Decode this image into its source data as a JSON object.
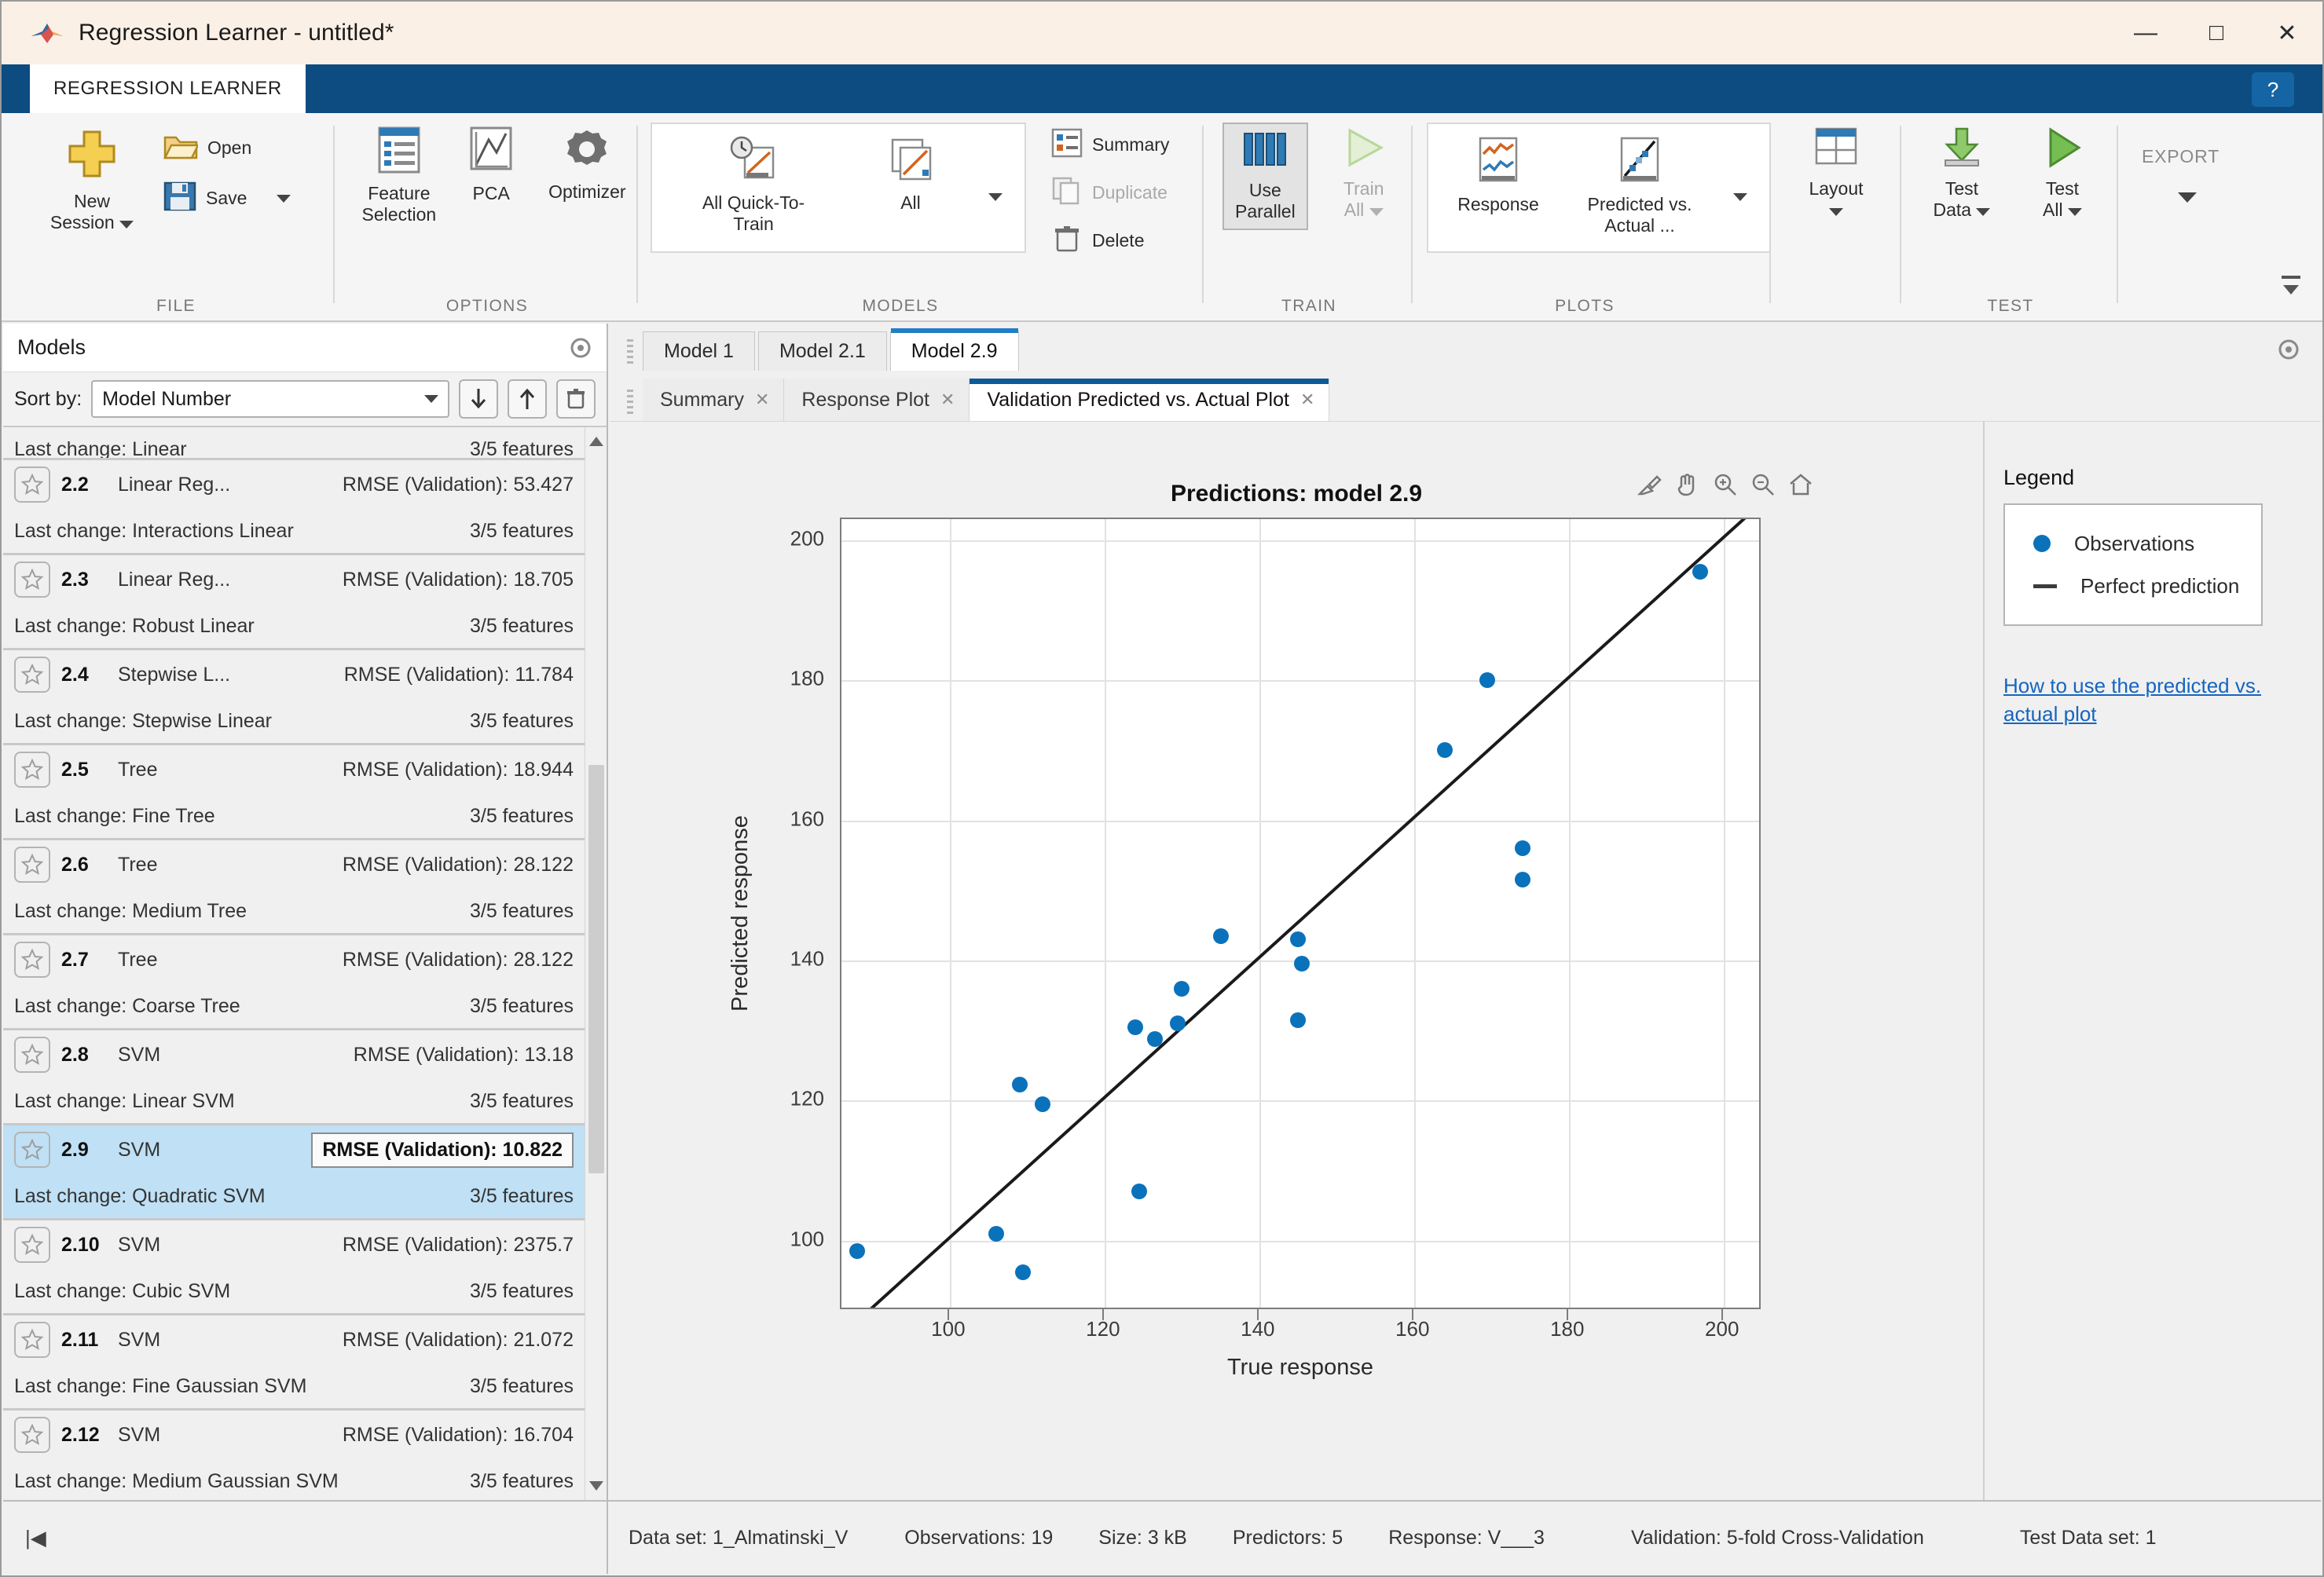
{
  "window": {
    "title": "Regression Learner - untitled*",
    "app_icon": "matlab-icon",
    "minimize": "—",
    "maximize": "□",
    "close": "✕"
  },
  "ribbon": {
    "tab_label": "REGRESSION LEARNER",
    "help_label": "?",
    "groups": [
      {
        "caption": "FILE"
      },
      {
        "caption": "OPTIONS"
      },
      {
        "caption": "MODELS"
      },
      {
        "caption": "TRAIN"
      },
      {
        "caption": "PLOTS"
      },
      {
        "caption": "TEST"
      },
      {
        "caption": ""
      }
    ],
    "file": {
      "new_session": "New\nSession",
      "new_session_line1": "New",
      "new_session_line2": "Session",
      "open": "Open",
      "save": "Save"
    },
    "options": {
      "feature_selection_line1": "Feature",
      "feature_selection_line2": "Selection",
      "pca": "PCA",
      "optimizer": "Optimizer"
    },
    "models": {
      "all_quick_line1": "All Quick-To-",
      "all_quick_line2": "Train",
      "all": "All",
      "summary": "Summary",
      "duplicate": "Duplicate",
      "delete": "Delete"
    },
    "train": {
      "use_parallel_line1": "Use",
      "use_parallel_line2": "Parallel",
      "train_all_line1": "Train",
      "train_all_line2": "All"
    },
    "plots": {
      "response": "Response",
      "predicted_vs_actual_line1": "Predicted vs.",
      "predicted_vs_actual_line2": "Actual",
      "predicted_vs_actual_more": "...",
      "layout": "Layout"
    },
    "test": {
      "test_data_line1": "Test",
      "test_data_line2": "Data",
      "test_all_line1": "Test",
      "test_all_line2": "All"
    },
    "export": {
      "label": "EXPORT"
    }
  },
  "models_panel": {
    "title": "Models",
    "sort_label": "Sort by:",
    "sort_value": "Model Number",
    "partial_row": {
      "change": "Last change: Linear",
      "features": "3/5 features"
    },
    "rows": [
      {
        "num": "2.2",
        "type": "Linear Reg...",
        "rmse": "RMSE (Validation): 53.427",
        "change": "Last change: Interactions Linear",
        "features": "3/5 features",
        "selected": false
      },
      {
        "num": "2.3",
        "type": "Linear Reg...",
        "rmse": "RMSE (Validation): 18.705",
        "change": "Last change: Robust Linear",
        "features": "3/5 features",
        "selected": false
      },
      {
        "num": "2.4",
        "type": "Stepwise L...",
        "rmse": "RMSE (Validation): 11.784",
        "change": "Last change: Stepwise Linear",
        "features": "3/5 features",
        "selected": false
      },
      {
        "num": "2.5",
        "type": "Tree",
        "rmse": "RMSE (Validation): 18.944",
        "change": "Last change: Fine Tree",
        "features": "3/5 features",
        "selected": false
      },
      {
        "num": "2.6",
        "type": "Tree",
        "rmse": "RMSE (Validation): 28.122",
        "change": "Last change: Medium Tree",
        "features": "3/5 features",
        "selected": false
      },
      {
        "num": "2.7",
        "type": "Tree",
        "rmse": "RMSE (Validation): 28.122",
        "change": "Last change: Coarse Tree",
        "features": "3/5 features",
        "selected": false
      },
      {
        "num": "2.8",
        "type": "SVM",
        "rmse": "RMSE (Validation): 13.18",
        "change": "Last change: Linear SVM",
        "features": "3/5 features",
        "selected": false
      },
      {
        "num": "2.9",
        "type": "SVM",
        "rmse": "RMSE (Validation): 10.822",
        "change": "Last change: Quadratic SVM",
        "features": "3/5 features",
        "selected": true
      },
      {
        "num": "2.10",
        "type": "SVM",
        "rmse": "RMSE (Validation): 2375.7",
        "change": "Last change: Cubic SVM",
        "features": "3/5 features",
        "selected": false
      },
      {
        "num": "2.11",
        "type": "SVM",
        "rmse": "RMSE (Validation): 21.072",
        "change": "Last change: Fine Gaussian SVM",
        "features": "3/5 features",
        "selected": false
      },
      {
        "num": "2.12",
        "type": "SVM",
        "rmse": "RMSE (Validation): 16.704",
        "change": "Last change: Medium Gaussian SVM",
        "features": "3/5 features",
        "selected": false
      }
    ]
  },
  "main": {
    "model_tabs": [
      {
        "label": "Model 1",
        "active": false
      },
      {
        "label": "Model 2.1",
        "active": false
      },
      {
        "label": "Model 2.9",
        "active": true
      }
    ],
    "sub_tabs": [
      {
        "label": "Summary",
        "active": false,
        "close": "✕"
      },
      {
        "label": "Response Plot",
        "active": false,
        "close": "✕"
      },
      {
        "label": "Validation Predicted vs. Actual Plot",
        "active": true,
        "close": "✕"
      }
    ]
  },
  "legend": {
    "title": "Legend",
    "items": [
      {
        "marker": "dot",
        "label": "Observations"
      },
      {
        "marker": "line",
        "label": "Perfect prediction"
      }
    ],
    "help_link": "How to use the predicted vs. actual plot"
  },
  "status_bar": {
    "nav_first": "|◀",
    "items": [
      "Data set: 1_Almatinski_V",
      "Observations: 19",
      "Size: 3 kB",
      "Predictors: 5",
      "Response: V___3",
      "Validation: 5-fold Cross-Validation",
      "Test Data set: 1"
    ]
  },
  "colors": {
    "accent_blue": "#0a72bb",
    "ribbon_blue": "#0c4c80",
    "selection_blue": "#bfe0f5",
    "link_blue": "#1565c0"
  },
  "chart_data": {
    "type": "scatter",
    "title": "Predictions: model 2.9",
    "xlabel": "True response",
    "ylabel": "Predicted response",
    "xlim": [
      86,
      205
    ],
    "ylim": [
      90,
      203
    ],
    "xticks": [
      100,
      120,
      140,
      160,
      180,
      200
    ],
    "yticks": [
      100,
      120,
      140,
      160,
      180,
      200
    ],
    "grid": true,
    "legend_position": "right-panel",
    "series": [
      {
        "name": "Observations",
        "marker": "circle",
        "color": "#0a72bb",
        "points": [
          [
            88.0,
            98.5
          ],
          [
            106.0,
            101.0
          ],
          [
            109.5,
            95.5
          ],
          [
            109.0,
            122.3
          ],
          [
            112.0,
            119.5
          ],
          [
            124.5,
            107.0
          ],
          [
            124.0,
            130.5
          ],
          [
            126.5,
            128.8
          ],
          [
            129.5,
            131.0
          ],
          [
            130.0,
            136.0
          ],
          [
            135.0,
            143.5
          ],
          [
            145.0,
            143.0
          ],
          [
            145.5,
            139.5
          ],
          [
            145.0,
            131.5
          ],
          [
            164.0,
            170.0
          ],
          [
            169.5,
            180.0
          ],
          [
            174.0,
            156.0
          ],
          [
            174.0,
            151.5
          ],
          [
            197.0,
            195.5
          ]
        ]
      },
      {
        "name": "Perfect prediction",
        "type": "line",
        "color": "#1a1a1a",
        "x": [
          86,
          205
        ],
        "y": [
          86,
          205
        ]
      }
    ]
  }
}
